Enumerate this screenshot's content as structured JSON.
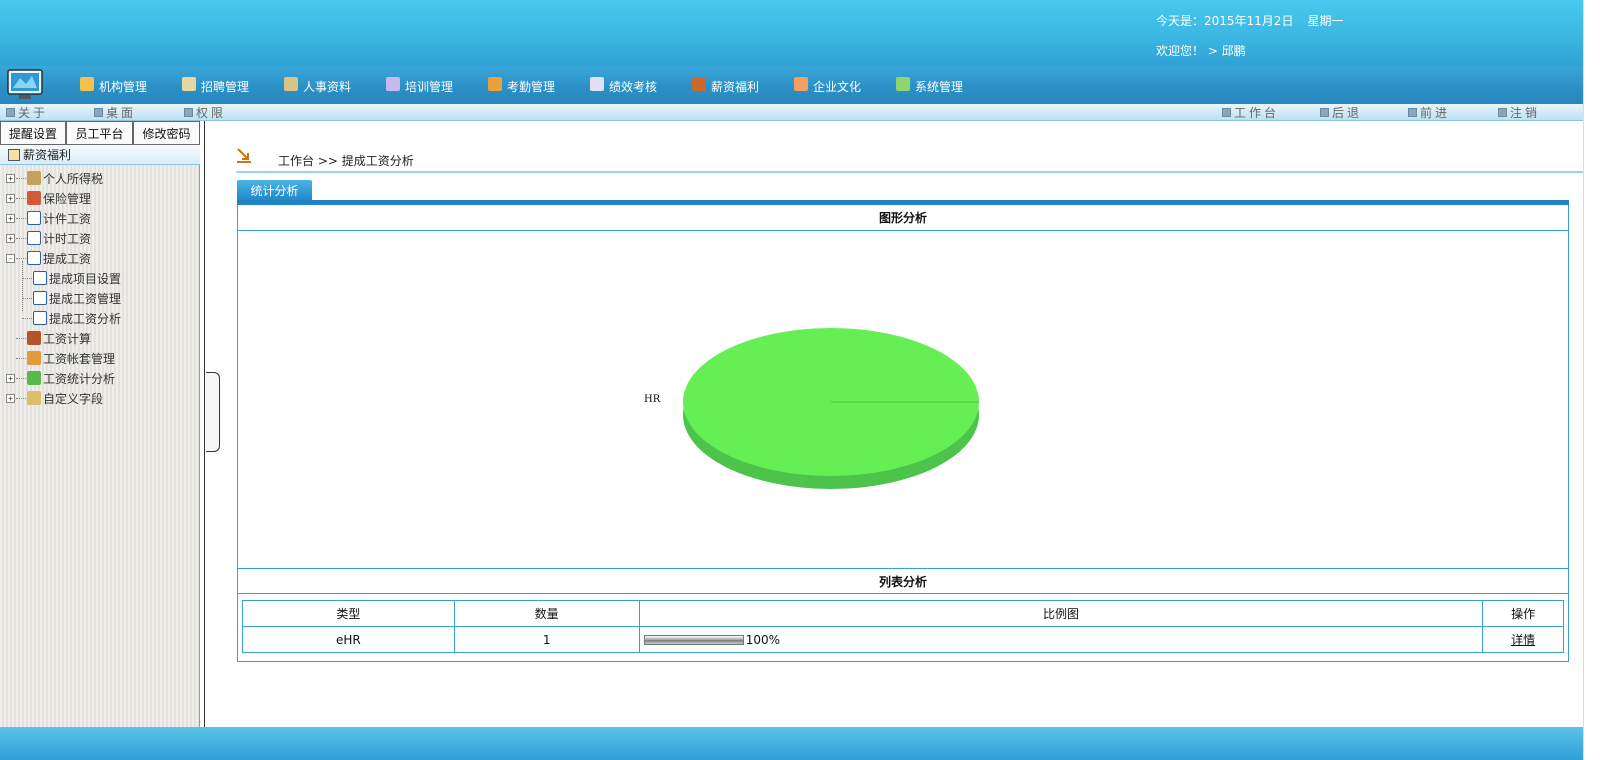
{
  "header": {
    "date_line": "今天是：2015年11月2日",
    "weekday": "星期一",
    "welcome": "欢迎您！ > 邱鹏"
  },
  "nav": {
    "items": [
      {
        "label": "机构管理",
        "icon": "org-icon",
        "color": "#f2c14e"
      },
      {
        "label": "招聘管理",
        "icon": "recruit-icon",
        "color": "#e8d7a0"
      },
      {
        "label": "人事资料",
        "icon": "people-icon",
        "color": "#d9c48a"
      },
      {
        "label": "培训管理",
        "icon": "training-icon",
        "color": "#c9b8f0"
      },
      {
        "label": "考勤管理",
        "icon": "attendance-icon",
        "color": "#e9a13c"
      },
      {
        "label": "绩效考核",
        "icon": "performance-icon",
        "color": "#e0e0f0"
      },
      {
        "label": "薪资福利",
        "icon": "salary-icon",
        "color": "#c76a2c"
      },
      {
        "label": "企业文化",
        "icon": "culture-icon",
        "color": "#f0a060"
      },
      {
        "label": "系统管理",
        "icon": "system-icon",
        "color": "#8fd56c"
      }
    ]
  },
  "toolbar": {
    "about": "关于",
    "desktop": "桌面",
    "permission": "权限",
    "workbench": "工作台",
    "back": "后退",
    "forward": "前进",
    "logout": "注销"
  },
  "sidebar": {
    "buttons": [
      "提醒设置",
      "员工平台",
      "修改密码"
    ],
    "title": "薪资福利",
    "tree": [
      {
        "label": "个人所得税",
        "expand": "+",
        "level": 0
      },
      {
        "label": "保险管理",
        "expand": "+",
        "level": 0
      },
      {
        "label": "计件工资",
        "expand": "+",
        "level": 0
      },
      {
        "label": "计时工资",
        "expand": "+",
        "level": 0
      },
      {
        "label": "提成工资",
        "expand": "-",
        "level": 0
      },
      {
        "label": "提成项目设置",
        "expand": "",
        "level": 1
      },
      {
        "label": "提成工资管理",
        "expand": "",
        "level": 1
      },
      {
        "label": "提成工资分析",
        "expand": "",
        "level": 1
      },
      {
        "label": "工资计算",
        "expand": "",
        "level": 0
      },
      {
        "label": "工资帐套管理",
        "expand": "",
        "level": 0
      },
      {
        "label": "工资统计分析",
        "expand": "+",
        "level": 0
      },
      {
        "label": "自定义字段",
        "expand": "+",
        "level": 0
      }
    ]
  },
  "main": {
    "breadcrumb": "工作台 >> 提成工资分析",
    "tab": "统计分析",
    "chart_header": "图形分析",
    "list_header": "列表分析",
    "table": {
      "columns": [
        "类型",
        "数量",
        "比例图",
        "操作"
      ],
      "rows": [
        {
          "type": "eHR",
          "count": "1",
          "percent": "100%",
          "ratio": 1.0,
          "action": "详情"
        }
      ]
    }
  },
  "chart_data": {
    "type": "pie",
    "slices": [
      {
        "label": "HR",
        "value": 1
      }
    ],
    "colors": [
      "#66ee55"
    ]
  }
}
